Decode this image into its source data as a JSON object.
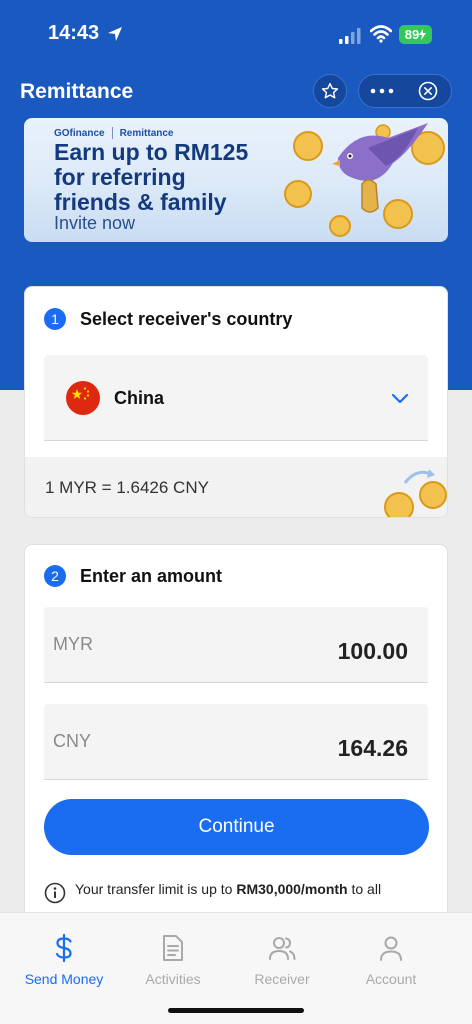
{
  "status_bar": {
    "time": "14:43",
    "battery": "89"
  },
  "header": {
    "title": "Remittance"
  },
  "banner": {
    "brand": "GOfinance",
    "section": "Remittance",
    "line1": "Earn up to RM125",
    "line2": "for referring",
    "line3": "friends & family",
    "cta": "Invite now"
  },
  "step1": {
    "number": "1",
    "title": "Select receiver's country",
    "country": "China",
    "rate": "1 MYR = 1.6426 CNY"
  },
  "step2": {
    "number": "2",
    "title": "Enter an amount",
    "send_currency": "MYR",
    "send_amount": "100.00",
    "receive_currency": "CNY",
    "receive_amount": "164.26",
    "continue_label": "Continue",
    "limit_prefix": "Your transfer limit is up to",
    "limit_value": "RM30,000/month",
    "limit_suffix": "to all countries."
  },
  "nav": {
    "items": [
      {
        "label": "Send Money",
        "icon": "dollar-icon",
        "active": true
      },
      {
        "label": "Activities",
        "icon": "document-icon",
        "active": false
      },
      {
        "label": "Receiver",
        "icon": "users-icon",
        "active": false
      },
      {
        "label": "Account",
        "icon": "user-icon",
        "active": false
      }
    ]
  },
  "colors": {
    "primary": "#1a59bf",
    "accent": "#1a6df0",
    "battery": "#34c759",
    "flag_red": "#de2910"
  }
}
